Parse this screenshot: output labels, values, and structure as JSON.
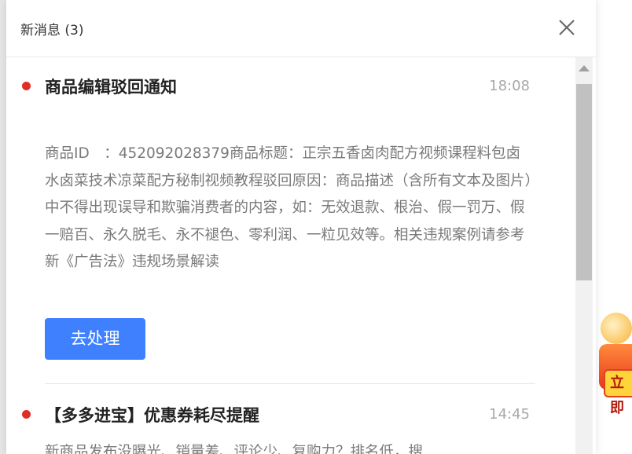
{
  "panel": {
    "title": "新消息 (3)"
  },
  "messages": [
    {
      "title": "商品编辑驳回通知",
      "time": "18:08",
      "body": "商品ID　：452092028379商品标题：正宗五香卤肉配方视频课程料包卤水卤菜技术凉菜配方秘制视频教程驳回原因：商品描述（含所有文本及图片）中不得出现误导和欺骗消费者的内容，如：无效退款、根治、假一罚万、假一赔百、永久脱毛、永不褪色、零利润、一粒见效等。相关违规案例请参考新《广告法》违规场景解读",
      "action_label": "去处理"
    },
    {
      "title": "【多多进宝】优惠券耗尽提醒",
      "time": "14:45",
      "body": "新商品发布没曝光、销量差、评论少、复购力？排名低，搜"
    }
  ],
  "promo": {
    "label": "立即"
  },
  "colors": {
    "accent_blue": "#3f80ff",
    "unread_dot": "#e02e24"
  }
}
